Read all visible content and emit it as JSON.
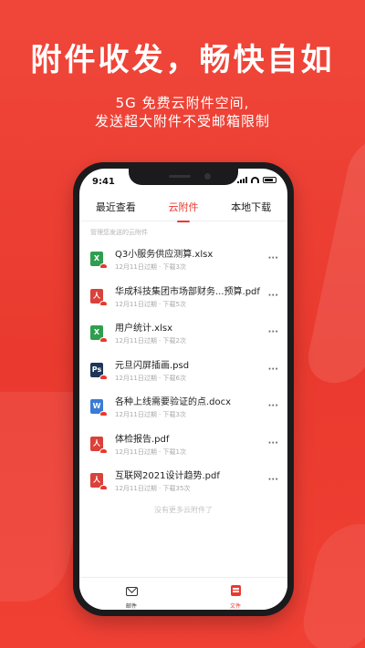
{
  "hero": {
    "title": "附件收发，畅快自如",
    "subtitle_line1": "5G 免费云附件空间,",
    "subtitle_line2": "发送超大附件不受邮箱限制"
  },
  "status_bar": {
    "time": "9:41"
  },
  "tabs": [
    {
      "label": "最近查看",
      "active": false
    },
    {
      "label": "云附件",
      "active": true
    },
    {
      "label": "本地下载",
      "active": false
    }
  ],
  "hint": "管理您发送的云附件",
  "files": [
    {
      "name": "Q3小服务供应测算.xlsx",
      "meta": "12月11日过期 · 下载3次",
      "type": "xlsx",
      "icon_letter": "X",
      "icon_color": "#2e9e4f"
    },
    {
      "name": "华成科技集团市场部财务...预算.pdf",
      "meta": "12月11日过期 · 下载5次",
      "type": "pdf",
      "icon_letter": "人",
      "icon_color": "#d9413a"
    },
    {
      "name": "用户统计.xlsx",
      "meta": "12月11日过期 · 下载2次",
      "type": "xlsx",
      "icon_letter": "X",
      "icon_color": "#2e9e4f"
    },
    {
      "name": "元旦闪屏插画.psd",
      "meta": "12月11日过期 · 下载6次",
      "type": "psd",
      "icon_letter": "Ps",
      "icon_color": "#1d3557"
    },
    {
      "name": "各种上线需要验证的点.docx",
      "meta": "12月11日过期 · 下载3次",
      "type": "docx",
      "icon_letter": "W",
      "icon_color": "#3a7bd5"
    },
    {
      "name": "体检报告.pdf",
      "meta": "12月11日过期 · 下载1次",
      "type": "pdf",
      "icon_letter": "人",
      "icon_color": "#d9413a"
    },
    {
      "name": "互联网2021设计趋势.pdf",
      "meta": "12月11日过期 · 下载35次",
      "type": "pdf",
      "icon_letter": "人",
      "icon_color": "#d9413a"
    }
  ],
  "more_label": "···",
  "end_note": "没有更多云附件了",
  "bottom_nav": [
    {
      "label": "邮件",
      "icon": "mail-icon",
      "active": false
    },
    {
      "label": "文件",
      "icon": "file-icon",
      "active": true
    }
  ],
  "colors": {
    "accent": "#e8392f",
    "background": "#ee4237"
  }
}
